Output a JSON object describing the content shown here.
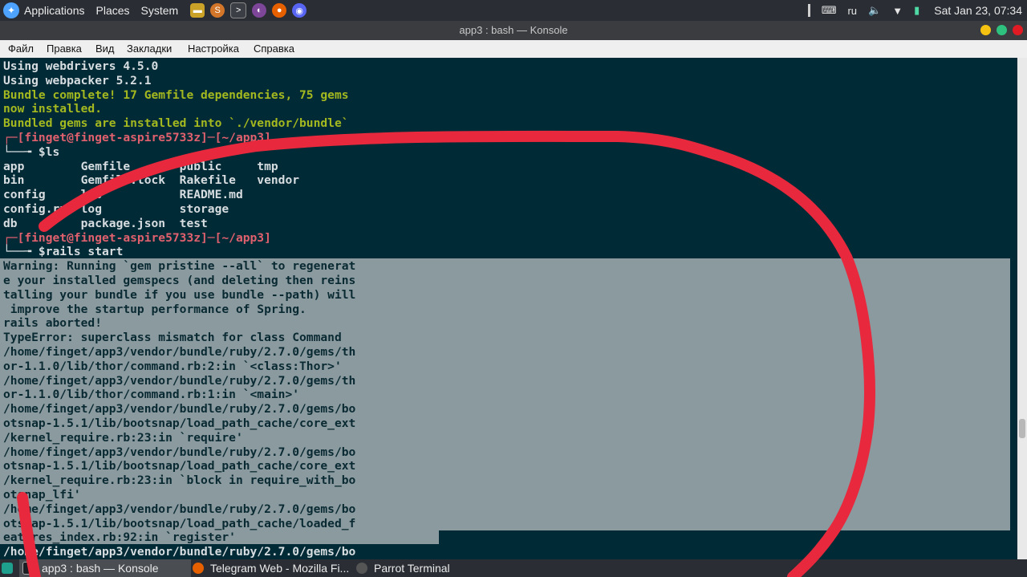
{
  "top_panel": {
    "menus": [
      "Applications",
      "Places",
      "System"
    ],
    "keyboard_layout": "ru",
    "clock": "Sat Jan 23, 07:34"
  },
  "window": {
    "title": "app3 : bash — Konsole"
  },
  "menubar": [
    "Файл",
    "Правка",
    "Вид",
    "Закладки",
    "Настройка",
    "Справка"
  ],
  "terminal": {
    "lines": [
      {
        "text": "Using webdrivers 4.5.0",
        "color": "white"
      },
      {
        "text": "Using webpacker 5.2.1",
        "color": "white"
      },
      {
        "text": "Bundle complete! 17 Gemfile dependencies, 75 gems",
        "color": "green"
      },
      {
        "text": "now installed.",
        "color": "green"
      },
      {
        "text": "Bundled gems are installed into `./vendor/bundle`",
        "color": "green"
      },
      {
        "text": "┌─[finget@finget-aspire5733z]─[~/app3]",
        "color": "red"
      },
      {
        "text": "└──╼ $ls",
        "color": "white"
      },
      {
        "text": "app        Gemfile       public     tmp",
        "color": "white"
      },
      {
        "text": "bin        Gemfile.lock  Rakefile   vendor",
        "color": "white"
      },
      {
        "text": "config     lib           README.md",
        "color": "white"
      },
      {
        "text": "config.ru  log           storage",
        "color": "white"
      },
      {
        "text": "db         package.json  test",
        "color": "white"
      },
      {
        "text": "┌─[finget@finget-aspire5733z]─[~/app3]",
        "color": "red"
      },
      {
        "text": "└──╼ $rails start",
        "color": "white"
      },
      {
        "text": "Warning: Running `gem pristine --all` to regenerat",
        "color": "sel"
      },
      {
        "text": "e your installed gemspecs (and deleting then reins",
        "color": "sel"
      },
      {
        "text": "talling your bundle if you use bundle --path) will",
        "color": "sel"
      },
      {
        "text": " improve the startup performance of Spring.",
        "color": "sel"
      },
      {
        "text": "rails aborted!",
        "color": "sel"
      },
      {
        "text": "TypeError: superclass mismatch for class Command",
        "color": "sel"
      },
      {
        "text": "/home/finget/app3/vendor/bundle/ruby/2.7.0/gems/th",
        "color": "sel"
      },
      {
        "text": "or-1.1.0/lib/thor/command.rb:2:in `<class:Thor>'",
        "color": "sel"
      },
      {
        "text": "/home/finget/app3/vendor/bundle/ruby/2.7.0/gems/th",
        "color": "sel"
      },
      {
        "text": "or-1.1.0/lib/thor/command.rb:1:in `<main>'",
        "color": "sel"
      },
      {
        "text": "/home/finget/app3/vendor/bundle/ruby/2.7.0/gems/bo",
        "color": "sel"
      },
      {
        "text": "otsnap-1.5.1/lib/bootsnap/load_path_cache/core_ext",
        "color": "sel"
      },
      {
        "text": "/kernel_require.rb:23:in `require'",
        "color": "sel"
      },
      {
        "text": "/home/finget/app3/vendor/bundle/ruby/2.7.0/gems/bo",
        "color": "sel"
      },
      {
        "text": "otsnap-1.5.1/lib/bootsnap/load_path_cache/core_ext",
        "color": "sel"
      },
      {
        "text": "/kernel_require.rb:23:in `block in require_with_bo",
        "color": "sel"
      },
      {
        "text": "otsnap_lfi'",
        "color": "sel"
      },
      {
        "text": "/home/finget/app3/vendor/bundle/ruby/2.7.0/gems/bo",
        "color": "sel"
      },
      {
        "text": "otsnap-1.5.1/lib/bootsnap/load_path_cache/loaded_f",
        "color": "sel"
      },
      {
        "text": "eatures_index.rb:92:in `register'",
        "color": "sel"
      },
      {
        "text": "/home/finget/app3/vendor/bundle/ruby/2.7.0/gems/bo",
        "color": "white"
      }
    ]
  },
  "taskbar": {
    "tasks": [
      {
        "label": "app3 : bash — Konsole",
        "active": true
      },
      {
        "label": "Telegram Web - Mozilla Fi...",
        "active": false
      },
      {
        "label": "Parrot Terminal",
        "active": false
      }
    ]
  },
  "colors": {
    "terminal_bg": "#002b36",
    "prompt_red": "#e0606e",
    "text_green": "#a4b81f",
    "selection": "#8a9a9e",
    "scribble": "#e8283c"
  }
}
